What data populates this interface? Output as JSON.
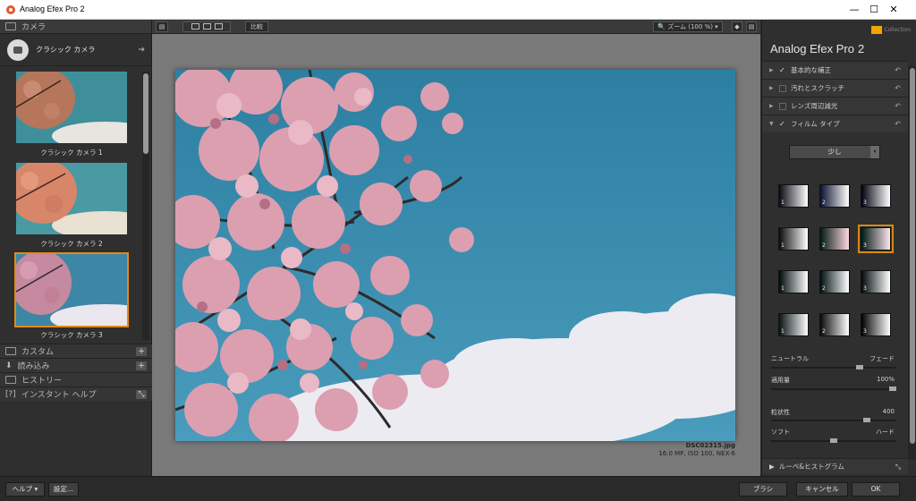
{
  "window": {
    "title": "Analog Efex Pro 2",
    "minimize": "—",
    "maximize": "☐",
    "close": "✕"
  },
  "left": {
    "camera_header": "カメラ",
    "camera_name": "クラシック カメラ",
    "presets": [
      {
        "label": "クラシック カメラ 1",
        "selected": false
      },
      {
        "label": "クラシック カメラ 2",
        "selected": false
      },
      {
        "label": "クラシック カメラ 3",
        "selected": true
      }
    ],
    "sections": [
      "カスタム",
      "読み込み",
      "ヒストリー",
      "インスタント ヘルプ"
    ]
  },
  "toolbar": {
    "compare": "比較",
    "zoom": "ズーム (100 %)"
  },
  "file": {
    "name": "DSC02315.jpg",
    "meta": "16.0 MP, ISO 100, NEX-6"
  },
  "right": {
    "brand": "Analog Efex Pro",
    "brand_version": "2",
    "collection": "Collection",
    "filters": [
      {
        "label": "基本的な補正",
        "checked": true,
        "expanded": false
      },
      {
        "label": "汚れとスクラッチ",
        "checked": false,
        "expanded": false
      },
      {
        "label": "レンズ周辺減光",
        "checked": false,
        "expanded": false
      },
      {
        "label": "フィルム タイプ",
        "checked": true,
        "expanded": true
      }
    ],
    "film_dropdown": "少し",
    "swatch_numbers": [
      "1",
      "2",
      "3"
    ],
    "selected_swatch": {
      "row": 1,
      "col": 2
    },
    "sliders": {
      "neutral_label": "ニュートラル",
      "fade_label": "フェード",
      "neutral_fade_value": 0.72,
      "strength_label": "適用量",
      "strength_value": "100%",
      "strength_fraction": 1.0,
      "grain_label": "粒状性",
      "grain_value": "400",
      "grain_fraction": 0.78,
      "soft_label": "ソフト",
      "hard_label": "ハード",
      "soft_hard_value": 0.5
    },
    "loupe": "ルーペ&ヒストグラム"
  },
  "bottom": {
    "help": "ヘルプ ▾",
    "settings": "設定...",
    "brush": "ブラシ",
    "cancel": "キャンセル",
    "ok": "OK"
  },
  "colors": {
    "accent": "#e58a12",
    "sky": "#3386a6",
    "blossom": "#d996a6"
  }
}
